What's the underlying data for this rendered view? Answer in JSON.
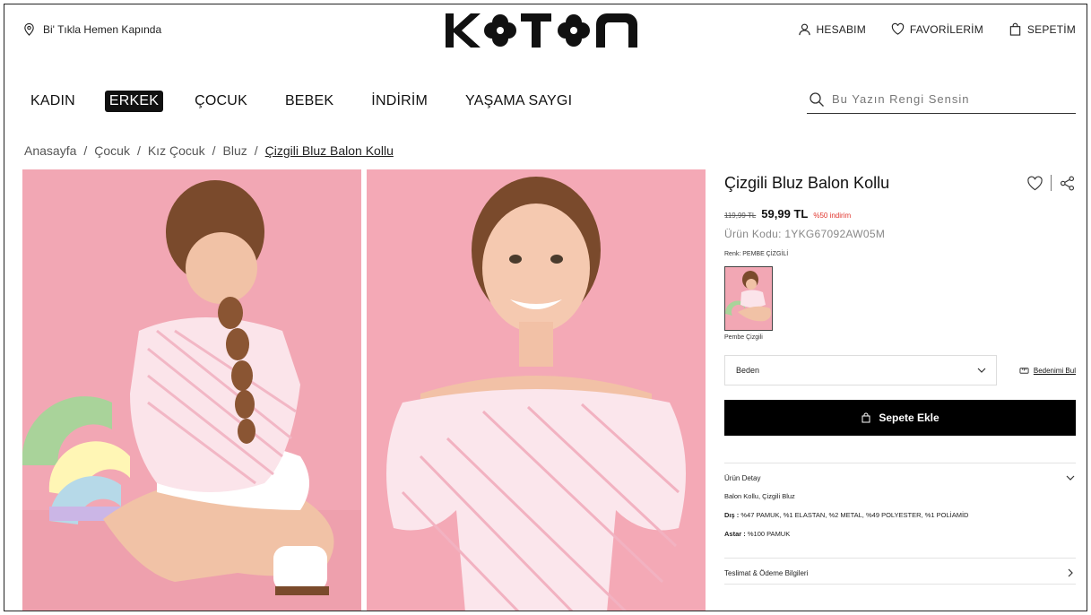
{
  "topbar": {
    "delivery_text": "Bi' Tıkla Hemen Kapında",
    "logo_text": "KOTON",
    "links": [
      {
        "label": "HESABIM",
        "icon": "user-icon"
      },
      {
        "label": "FAVORİLERİM",
        "icon": "heart-icon"
      },
      {
        "label": "SEPETİM",
        "icon": "bag-icon"
      }
    ]
  },
  "nav": {
    "items": [
      {
        "label": "KADIN",
        "active": false
      },
      {
        "label": "ERKEK",
        "active": true
      },
      {
        "label": "ÇOCUK",
        "active": false
      },
      {
        "label": "BEBEK",
        "active": false
      },
      {
        "label": "İNDİRİM",
        "active": false
      },
      {
        "label": "YAŞAMA SAYGI",
        "active": false
      }
    ],
    "search_placeholder": "Bu Yazın Rengi Sensin"
  },
  "breadcrumb": [
    "Anasayfa",
    "Çocuk",
    "Kız Çocuk",
    "Bluz",
    "Çizgili Bluz Balon Kollu"
  ],
  "product": {
    "title": "Çizgili Bluz Balon Kollu",
    "old_price": "119,99 TL",
    "price": "59,99 TL",
    "discount": "%50 indirim",
    "code": "Ürün Kodu: 1YKG67092AW05M",
    "color_label": "Renk: PEMBE ÇİZGİLİ",
    "swatch_name": "Pembe Çizgili",
    "size_label": "Beden",
    "size_guide": "Bedenimi Bul",
    "add_to_cart": "Sepete Ekle",
    "detail_title": "Ürün Detay",
    "detail_desc": "Balon Kollu, Çizgili Bluz",
    "outer_label": "Dış :",
    "outer_value": " %47 PAMUK, %1 ELASTAN, %2 METAL, %49 POLYESTER, %1 POLİAMİD",
    "lining_label": "Astar :",
    "lining_value": " %100 PAMUK",
    "shipping_title": "Teslimat & Ödeme Bilgileri"
  },
  "colors": {
    "background_pink": "#f2a7b4",
    "accent_red": "#e0342c",
    "button_black": "#000000"
  }
}
